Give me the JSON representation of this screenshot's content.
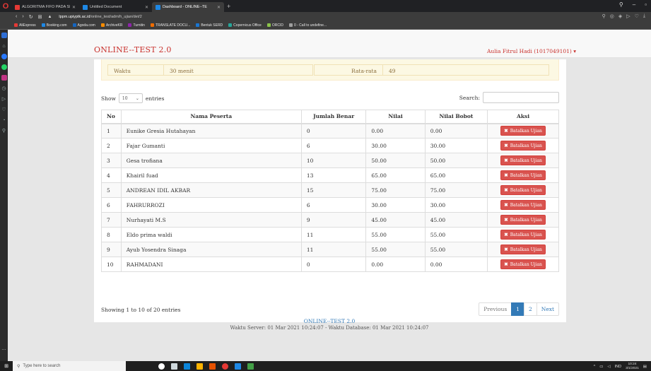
{
  "browser": {
    "tabs": [
      {
        "title": "ALGORITMA FIFO PADA SI"
      },
      {
        "title": "Untitled Document"
      },
      {
        "title": "Dashboard - ONLINE--TE"
      }
    ],
    "new_tab": "+",
    "url_host": "lppm.upiyptk.ac.id",
    "url_path": "/online_test/adm/h_ujian/det/2",
    "bookmarks": [
      "AliExpress",
      "Booking.com",
      "Agoda.com",
      "ArchiveKR",
      "Turnitin",
      "TRANSLATE DOCU...",
      "Bentuk SERD",
      "Copernicus Office",
      "ORCID",
      "0 - Call to undefine..."
    ],
    "colors": {
      "bookmark_dots": [
        "#e53935",
        "#1e88e5",
        "#1565c0",
        "#fb8c00",
        "#8e24aa",
        "#ef6c00",
        "#1976d2",
        "#26a69a",
        "#8bc34a",
        "#9e9e9e"
      ]
    }
  },
  "app": {
    "brand": "ONLINE--TEST 2.0",
    "user": "Aulia Fitrul Hadi (1017049101)",
    "user_caret": "▾"
  },
  "summary": {
    "waktu_label": "Waktu",
    "waktu_value": "30 menit",
    "rata_label": "Rata-rata",
    "rata_value": "49"
  },
  "table_controls": {
    "show_label": "Show",
    "length_value": "10",
    "entries_label": "entries",
    "search_label": "Search:"
  },
  "table": {
    "headers": [
      "No",
      "Nama Peserta",
      "Jumlah Benar",
      "Nilai",
      "Nilai Bobot",
      "Aksi"
    ],
    "action_label": "Batalkan Ujian",
    "rows": [
      {
        "no": "1",
        "nama": "Eunike Gresia Hutahayan",
        "benar": "0",
        "nilai": "0.00",
        "bobot": "0.00"
      },
      {
        "no": "2",
        "nama": "Fajar Gumanti",
        "benar": "6",
        "nilai": "30.00",
        "bobot": "30.00"
      },
      {
        "no": "3",
        "nama": "Gesa trofiana",
        "benar": "10",
        "nilai": "50.00",
        "bobot": "50.00"
      },
      {
        "no": "4",
        "nama": "Khairil fuad",
        "benar": "13",
        "nilai": "65.00",
        "bobot": "65.00"
      },
      {
        "no": "5",
        "nama": "ANDREAN IDIL AKBAR",
        "benar": "15",
        "nilai": "75.00",
        "bobot": "75.00"
      },
      {
        "no": "6",
        "nama": "FAHRURROZI",
        "benar": "6",
        "nilai": "30.00",
        "bobot": "30.00"
      },
      {
        "no": "7",
        "nama": "Nurhayati M.S",
        "benar": "9",
        "nilai": "45.00",
        "bobot": "45.00"
      },
      {
        "no": "8",
        "nama": "Eldo prima waldi",
        "benar": "11",
        "nilai": "55.00",
        "bobot": "55.00"
      },
      {
        "no": "9",
        "nama": "Ayub Yosendra Sinaga",
        "benar": "11",
        "nilai": "55.00",
        "bobot": "55.00"
      },
      {
        "no": "10",
        "nama": "RAHMADANI",
        "benar": "0",
        "nilai": "0.00",
        "bobot": "0.00"
      }
    ]
  },
  "pagination": {
    "info": "Showing 1 to 10 of 20 entries",
    "previous": "Previous",
    "page1": "1",
    "page2": "2",
    "next": "Next"
  },
  "footer": {
    "app_name": "ONLINE--TEST 2.0",
    "server_time": "Waktu Server: 01 Mar 2021 10:24:07 - Waktu Database: 01 Mar 2021 10:24:07"
  },
  "taskbar": {
    "search_placeholder": "Type here to search",
    "lang": "IND",
    "time": "10:24",
    "date": "3/1/2021"
  }
}
